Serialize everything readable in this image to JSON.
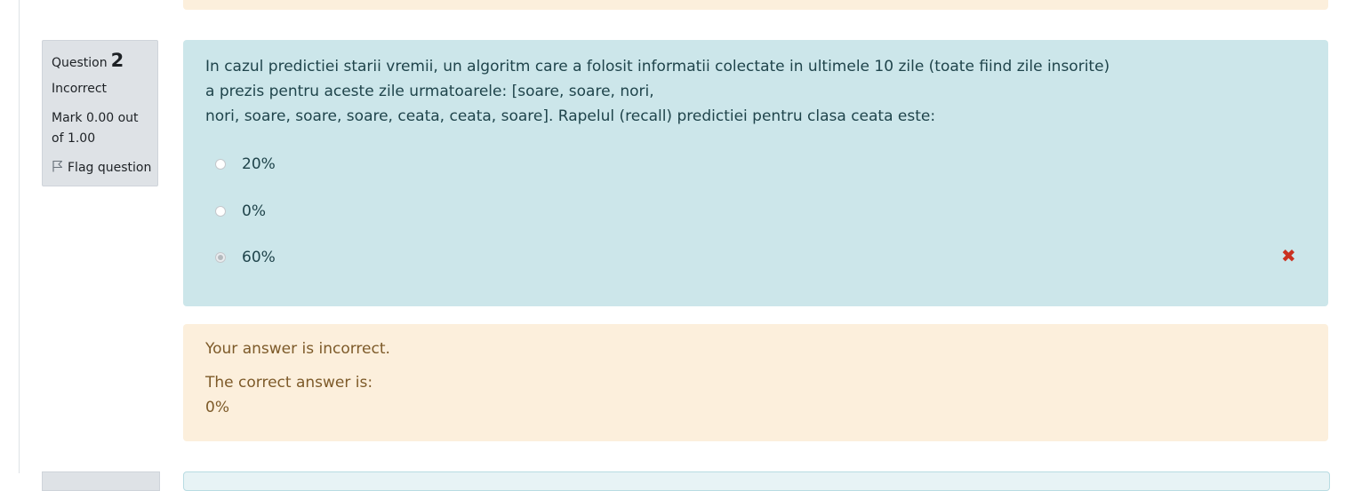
{
  "question_info": {
    "number_label": "Question",
    "number": "2",
    "state": "Incorrect",
    "grade": "Mark 0.00 out of 1.00",
    "flag_label": "Flag question"
  },
  "question_text": {
    "line1": "In cazul predictiei starii vremii, un algoritm care a folosit informatii colectate in ultimele 10 zile (toate fiind zile insorite)",
    "line2": "a prezis pentru aceste zile urmatoarele: [soare, soare, nori,",
    "line3": "nori, soare, soare, soare, ceata, ceata, soare]. Rapelul (recall) predictiei pentru clasa ceata este:"
  },
  "options": [
    {
      "label": "20%",
      "selected": false
    },
    {
      "label": "0%",
      "selected": false
    },
    {
      "label": "60%",
      "selected": true
    }
  ],
  "outcome": {
    "feedback": "Your answer is incorrect.",
    "right_answer_label": "The correct answer is:",
    "right_answer_value": "0%"
  },
  "icons": {
    "flag": "flag-icon",
    "incorrect": "cross-icon"
  },
  "colors": {
    "info_bg": "#dee2e6",
    "formulation_bg": "#cce6ea",
    "outcome_bg": "#fcefdc",
    "incorrect_red": "#ca3120"
  }
}
